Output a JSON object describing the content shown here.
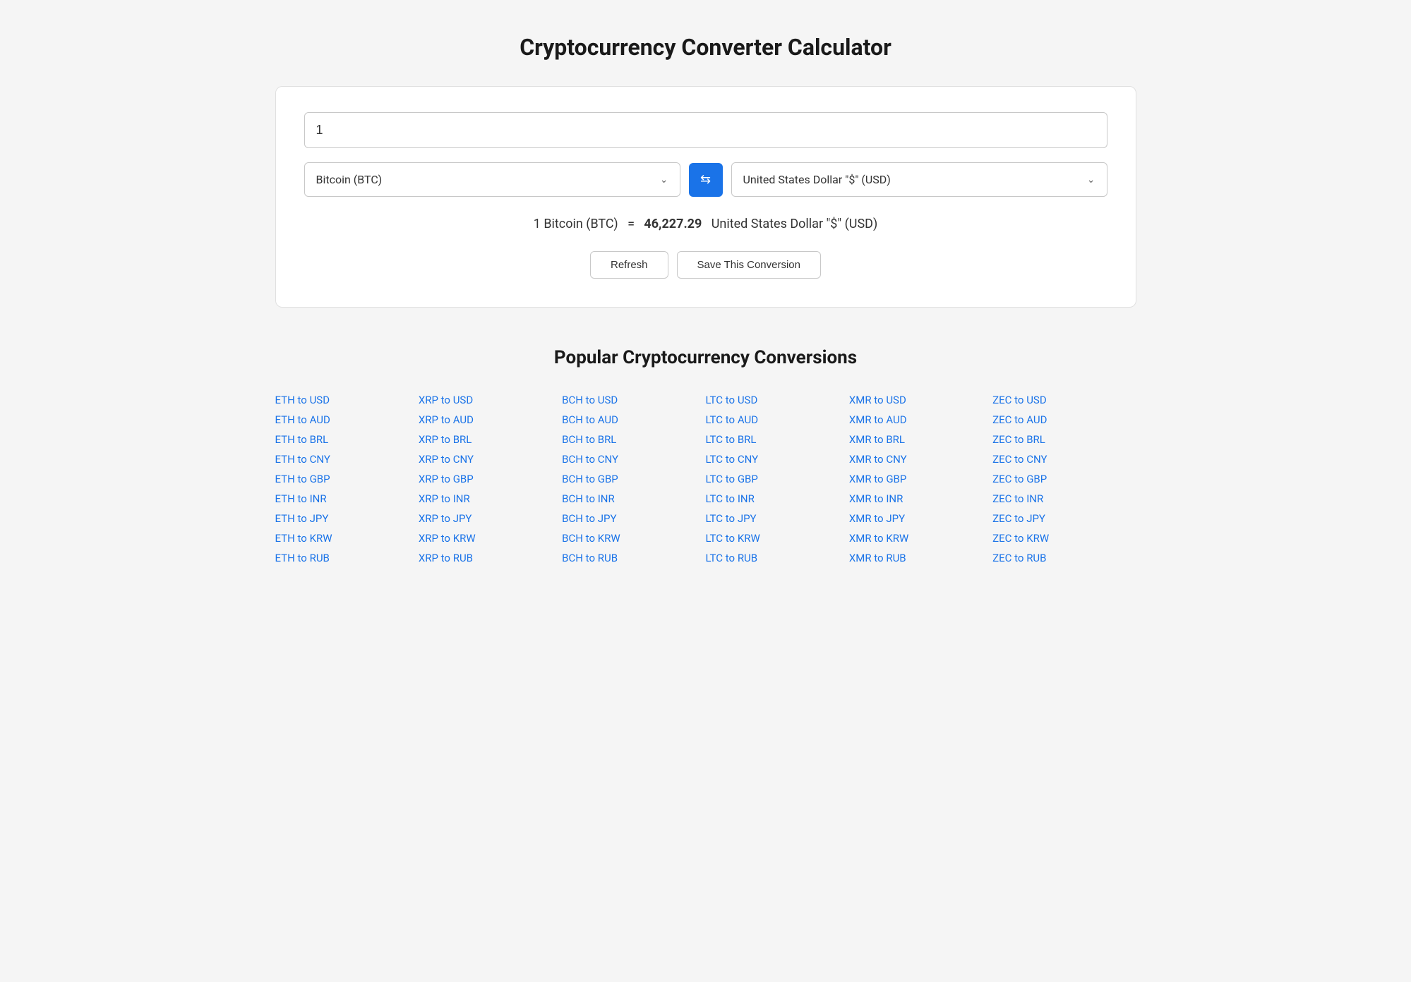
{
  "page": {
    "title": "Cryptocurrency Converter Calculator"
  },
  "converter": {
    "amount_value": "1",
    "from_currency": "Bitcoin (BTC)",
    "to_currency": "United States Dollar \"$\" (USD)",
    "result_text": "1 Bitcoin (BTC)",
    "result_equals": "=",
    "result_value": "46,227.29",
    "result_currency": "United States Dollar \"$\" (USD)",
    "swap_icon": "⇌",
    "chevron_down": "∨",
    "refresh_label": "Refresh",
    "save_label": "Save This Conversion"
  },
  "popular": {
    "title": "Popular Cryptocurrency Conversions",
    "columns": [
      {
        "id": "eth",
        "links": [
          "ETH to USD",
          "ETH to AUD",
          "ETH to BRL",
          "ETH to CNY",
          "ETH to GBP",
          "ETH to INR",
          "ETH to JPY",
          "ETH to KRW",
          "ETH to RUB"
        ]
      },
      {
        "id": "xrp",
        "links": [
          "XRP to USD",
          "XRP to AUD",
          "XRP to BRL",
          "XRP to CNY",
          "XRP to GBP",
          "XRP to INR",
          "XRP to JPY",
          "XRP to KRW",
          "XRP to RUB"
        ]
      },
      {
        "id": "bch",
        "links": [
          "BCH to USD",
          "BCH to AUD",
          "BCH to BRL",
          "BCH to CNY",
          "BCH to GBP",
          "BCH to INR",
          "BCH to JPY",
          "BCH to KRW",
          "BCH to RUB"
        ]
      },
      {
        "id": "ltc",
        "links": [
          "LTC to USD",
          "LTC to AUD",
          "LTC to BRL",
          "LTC to CNY",
          "LTC to GBP",
          "LTC to INR",
          "LTC to JPY",
          "LTC to KRW",
          "LTC to RUB"
        ]
      },
      {
        "id": "xmr",
        "links": [
          "XMR to USD",
          "XMR to AUD",
          "XMR to BRL",
          "XMR to CNY",
          "XMR to GBP",
          "XMR to INR",
          "XMR to JPY",
          "XMR to KRW",
          "XMR to RUB"
        ]
      },
      {
        "id": "zec",
        "links": [
          "ZEC to USD",
          "ZEC to AUD",
          "ZEC to BRL",
          "ZEC to CNY",
          "ZEC to GBP",
          "ZEC to INR",
          "ZEC to JPY",
          "ZEC to KRW",
          "ZEC to RUB"
        ]
      }
    ]
  }
}
